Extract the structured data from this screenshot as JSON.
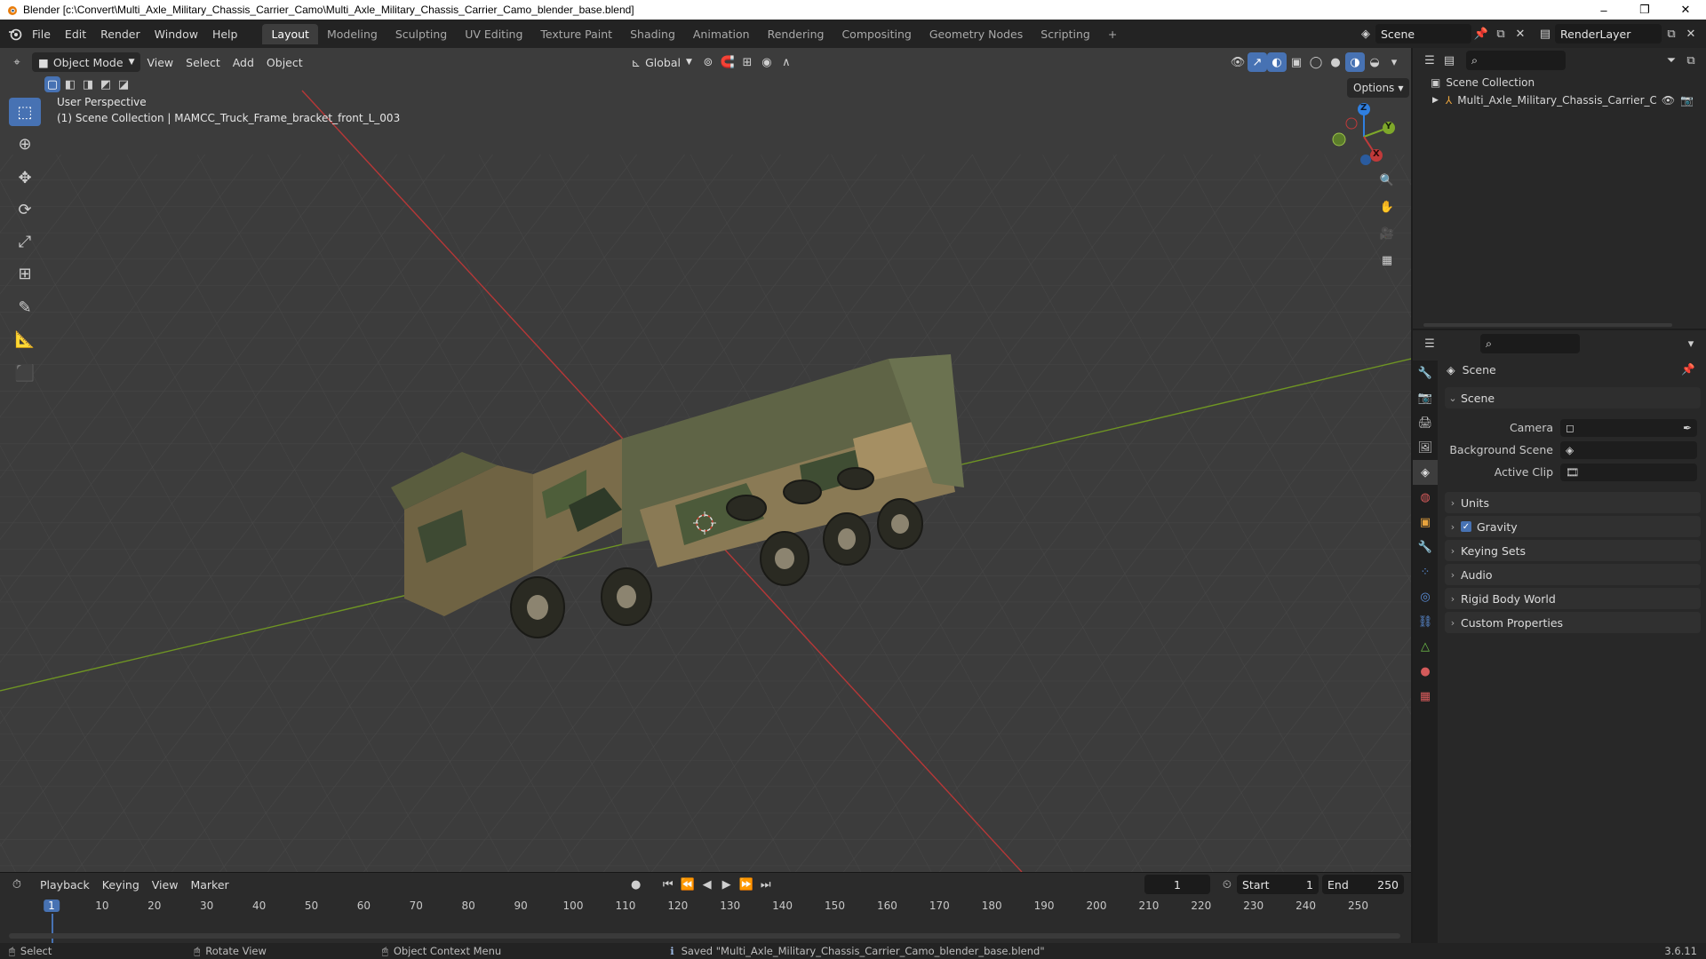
{
  "window": {
    "title": "Blender [c:\\Convert\\Multi_Axle_Military_Chassis_Carrier_Camo\\Multi_Axle_Military_Chassis_Carrier_Camo_blender_base.blend]",
    "minimize": "–",
    "maximize": "❐",
    "close": "✕"
  },
  "menu": [
    "File",
    "Edit",
    "Render",
    "Window",
    "Help"
  ],
  "workspaces": [
    "Layout",
    "Modeling",
    "Sculpting",
    "UV Editing",
    "Texture Paint",
    "Shading",
    "Animation",
    "Rendering",
    "Compositing",
    "Geometry Nodes",
    "Scripting"
  ],
  "workspace_add": "+",
  "scene_name": "Scene",
  "view_layer": "RenderLayer",
  "viewport": {
    "mode": "Object Mode",
    "menus": [
      "View",
      "Select",
      "Add",
      "Object"
    ],
    "orientation": "Global",
    "options": "Options",
    "perspective": "User Perspective",
    "collection_info": "(1) Scene Collection | MAMCC_Truck_Frame_bracket_front_L_003",
    "gizmo": {
      "x": "X",
      "y": "Y",
      "z": "Z"
    }
  },
  "timeline": {
    "menus": [
      "Playback",
      "Keying",
      "View",
      "Marker"
    ],
    "current_frame": "1",
    "start_label": "Start",
    "start": "1",
    "end_label": "End",
    "end": "250",
    "ticks": [
      "1",
      "10",
      "20",
      "30",
      "40",
      "50",
      "60",
      "70",
      "80",
      "90",
      "100",
      "110",
      "120",
      "130",
      "140",
      "150",
      "160",
      "170",
      "180",
      "190",
      "200",
      "210",
      "220",
      "230",
      "240",
      "250"
    ]
  },
  "status": {
    "select": "Select",
    "rotate": "Rotate View",
    "context": "Object Context Menu",
    "message": "Saved \"Multi_Axle_Military_Chassis_Carrier_Camo_blender_base.blend\"",
    "version": "3.6.11"
  },
  "outliner": {
    "root": "Scene Collection",
    "items": [
      "Multi_Axle_Military_Chassis_Carrier_Car"
    ]
  },
  "properties": {
    "header": "Scene",
    "panel": "Scene",
    "fields": [
      {
        "label": "Camera"
      },
      {
        "label": "Background Scene"
      },
      {
        "label": "Active Clip"
      }
    ],
    "sections": [
      "Units",
      "Gravity",
      "Keying Sets",
      "Audio",
      "Rigid Body World",
      "Custom Properties"
    ],
    "gravity_checked": true
  },
  "colors": {
    "accent": "#4772b3",
    "x_axis": "#c03a3a",
    "y_axis": "#7ea82a",
    "z_axis": "#2f7fe0",
    "viewport_bg": "#3d3d3d",
    "current_frame": "#4772b3"
  }
}
